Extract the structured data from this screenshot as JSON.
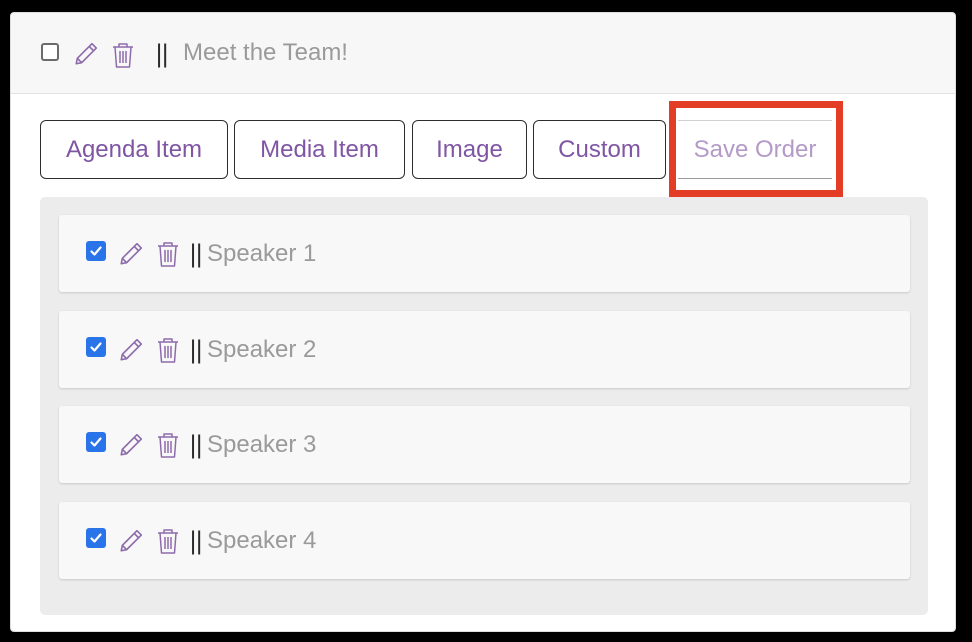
{
  "section": {
    "title": "Meet the Team!",
    "drag_handle": "||",
    "icons": {
      "edit": "pencil-icon",
      "delete": "trash-icon"
    }
  },
  "toolbar": {
    "agenda_item_label": "Agenda Item",
    "media_item_label": "Media Item",
    "image_label": "Image",
    "custom_label": "Custom",
    "save_order_label": "Save Order"
  },
  "items": [
    {
      "label": "Speaker 1",
      "checked": true,
      "drag_handle": "||"
    },
    {
      "label": "Speaker 2",
      "checked": true,
      "drag_handle": "||"
    },
    {
      "label": "Speaker 3",
      "checked": true,
      "drag_handle": "||"
    },
    {
      "label": "Speaker 4",
      "checked": true,
      "drag_handle": "||"
    }
  ],
  "colors": {
    "accent": "#7f55a4",
    "checkbox": "#2a74ea",
    "highlight": "#e43d26",
    "muted_text": "#9a9a9a"
  }
}
